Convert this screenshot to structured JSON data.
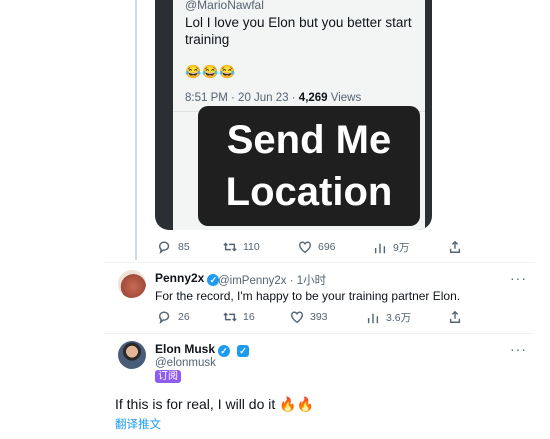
{
  "quoted_tweet_media": {
    "handle": "@MarioNawfal",
    "text": "Lol I love you Elon but you better start training",
    "emoji": "😂😂😂",
    "time": "8:51 PM · 20 Jun 23 · ",
    "views_count": "4,269",
    "views_label": " Views",
    "sign_line1": "Send Me",
    "sign_line2": "Location"
  },
  "tweet_actions": {
    "replies": "85",
    "retweets": "110",
    "likes": "696",
    "views": "9万"
  },
  "reply1": {
    "name": "Penny2x",
    "handle": "@imPenny2x · 1小时",
    "text": "For the record, I'm happy to be your training partner Elon.",
    "replies": "26",
    "retweets": "16",
    "likes": "393",
    "views": "3.6万"
  },
  "reply2": {
    "name": "Elon Musk",
    "handle": "@elonmusk",
    "badge": "订阅",
    "text": "If this is for real, I will do it 🔥🔥",
    "translate": "翻译推文"
  },
  "colors": {
    "accent": "#1d9bf0",
    "muted": "#536471",
    "subscribe_badge": "#8f5cf0"
  }
}
